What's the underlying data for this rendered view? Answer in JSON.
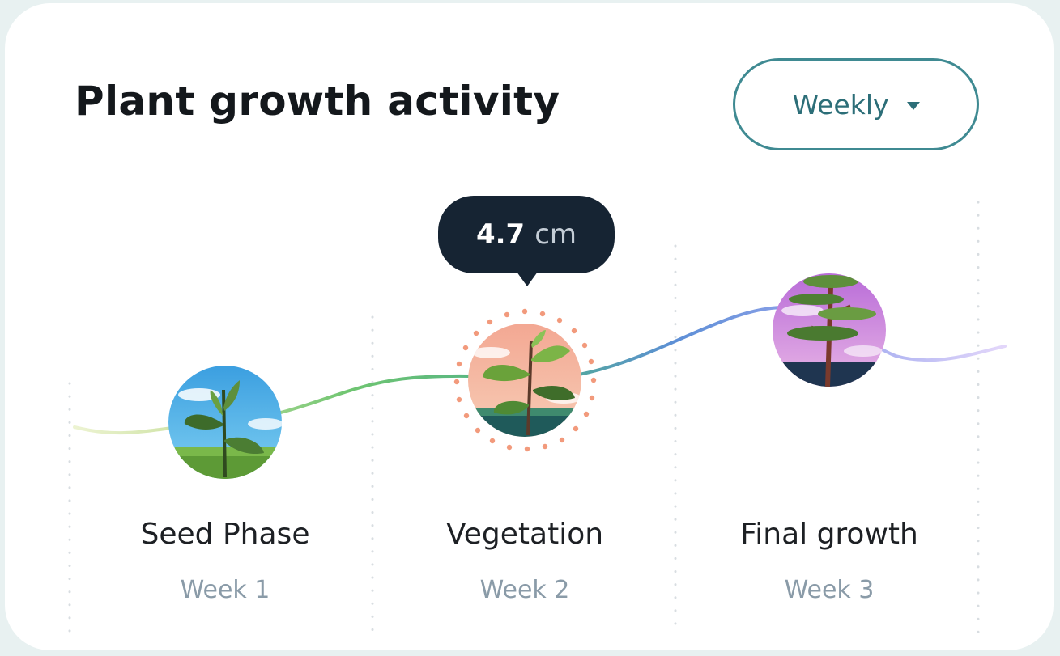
{
  "header": {
    "title": "Plant growth activity"
  },
  "period_select": {
    "selected": "Weekly"
  },
  "tooltip": {
    "value": "4.7",
    "unit": "cm"
  },
  "phases": [
    {
      "name": "Seed Phase",
      "week": "Week 1"
    },
    {
      "name": "Vegetation",
      "week": "Week 2"
    },
    {
      "name": "Final growth",
      "week": "Week 3"
    }
  ],
  "colors": {
    "accent": "#3f8a92",
    "tooltip_bg": "#162433",
    "line_start": "#e3eec0",
    "line_green": "#5cc06a",
    "line_blue": "#5d8fd6",
    "line_purple": "#c7b2f4",
    "highlight_dots": "#f29a7c"
  }
}
